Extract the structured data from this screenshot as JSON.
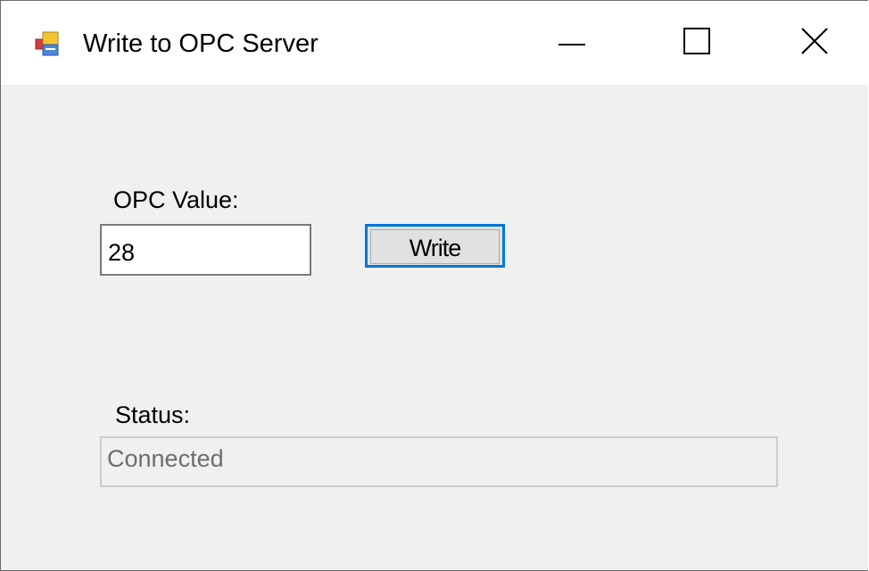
{
  "window": {
    "title": "Write to OPC Server",
    "icon": "windows-forms-app-icon",
    "controls": {
      "minimize": "minimize-icon",
      "maximize": "maximize-icon",
      "close": "close-icon"
    }
  },
  "form": {
    "opc_value_label": "OPC Value:",
    "opc_value": "28",
    "write_button_label": "Write",
    "status_label": "Status:",
    "status_value": "Connected"
  },
  "colors": {
    "focus_border": "#0078d7",
    "form_background": "#f0f0f0",
    "titlebar_background": "#ffffff"
  }
}
